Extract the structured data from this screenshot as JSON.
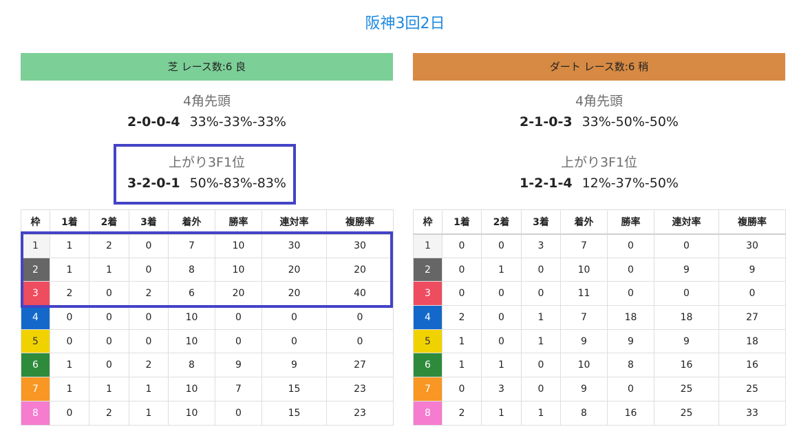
{
  "page": {
    "title": "阪神3回2日"
  },
  "columns": [
    "枠",
    "1着",
    "2着",
    "3着",
    "着外",
    "勝率",
    "連対率",
    "複勝率"
  ],
  "waku_colors": {
    "1": {
      "bg": "#f4f4f4",
      "fg": "#333333"
    },
    "2": {
      "bg": "#666666",
      "fg": "#ffffff"
    },
    "3": {
      "bg": "#ee4c5f",
      "fg": "#ffffff"
    },
    "4": {
      "bg": "#1468c9",
      "fg": "#ffffff"
    },
    "5": {
      "bg": "#f0d200",
      "fg": "#333333"
    },
    "6": {
      "bg": "#2e8b3c",
      "fg": "#ffffff"
    },
    "7": {
      "bg": "#f89723",
      "fg": "#ffffff"
    },
    "8": {
      "bg": "#f57ccf",
      "fg": "#ffffff"
    }
  },
  "panels": {
    "left": {
      "header": "芝 レース数:6  良",
      "header_color": "#7ccf97",
      "corner4": {
        "label": "4角先頭",
        "record": "2-0-0-4",
        "rates": "33%-33%-33%"
      },
      "agari": {
        "label": "上がり3F1位",
        "record": "3-2-0-1",
        "rates": "50%-83%-83%"
      },
      "rows": [
        [
          "1",
          "1",
          "2",
          "0",
          "7",
          "10",
          "30",
          "30"
        ],
        [
          "2",
          "1",
          "1",
          "0",
          "8",
          "10",
          "20",
          "20"
        ],
        [
          "3",
          "2",
          "0",
          "2",
          "6",
          "20",
          "20",
          "40"
        ],
        [
          "4",
          "0",
          "0",
          "0",
          "10",
          "0",
          "0",
          "0"
        ],
        [
          "5",
          "0",
          "0",
          "0",
          "10",
          "0",
          "0",
          "0"
        ],
        [
          "6",
          "1",
          "0",
          "2",
          "8",
          "9",
          "9",
          "27"
        ],
        [
          "7",
          "1",
          "1",
          "1",
          "10",
          "7",
          "15",
          "23"
        ],
        [
          "8",
          "0",
          "2",
          "1",
          "10",
          "0",
          "15",
          "23"
        ]
      ]
    },
    "right": {
      "header": "ダート レース数:6  稍",
      "header_color": "#d68a43",
      "corner4": {
        "label": "4角先頭",
        "record": "2-1-0-3",
        "rates": "33%-50%-50%"
      },
      "agari": {
        "label": "上がり3F1位",
        "record": "1-2-1-4",
        "rates": "12%-37%-50%"
      },
      "rows": [
        [
          "1",
          "0",
          "0",
          "3",
          "7",
          "0",
          "0",
          "30"
        ],
        [
          "2",
          "0",
          "1",
          "0",
          "10",
          "0",
          "9",
          "9"
        ],
        [
          "3",
          "0",
          "0",
          "0",
          "11",
          "0",
          "0",
          "0"
        ],
        [
          "4",
          "2",
          "0",
          "1",
          "7",
          "18",
          "18",
          "27"
        ],
        [
          "5",
          "1",
          "0",
          "1",
          "9",
          "9",
          "9",
          "18"
        ],
        [
          "6",
          "1",
          "1",
          "0",
          "10",
          "8",
          "16",
          "16"
        ],
        [
          "7",
          "0",
          "3",
          "0",
          "9",
          "0",
          "25",
          "25"
        ],
        [
          "8",
          "2",
          "1",
          "1",
          "8",
          "16",
          "25",
          "33"
        ]
      ]
    }
  },
  "highlight_color": "#4343c6"
}
